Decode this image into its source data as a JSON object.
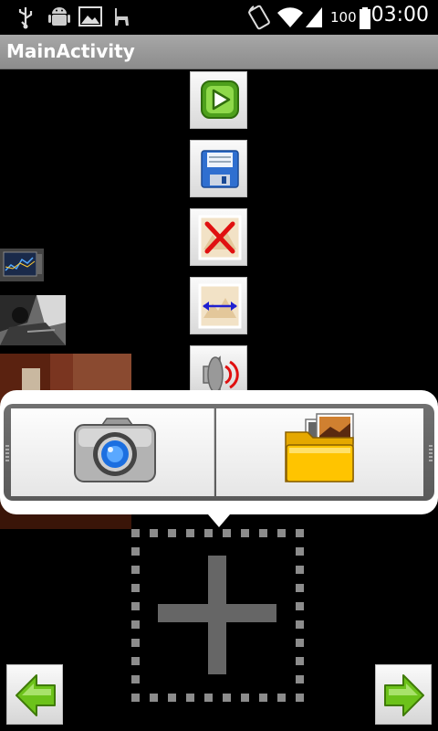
{
  "status_bar": {
    "battery_percent": "100",
    "time": "03:00",
    "notification_icons": [
      "usb-icon",
      "android-icon",
      "image-icon",
      "llama-icon"
    ],
    "system_icons": [
      "rotate-icon",
      "wifi-icon",
      "signal-icon",
      "battery-icon"
    ]
  },
  "title_bar": {
    "title": "MainActivity"
  },
  "toolbar": {
    "buttons": [
      "play-icon",
      "save-icon",
      "delete-icon",
      "resize-icon",
      "sound-icon"
    ]
  },
  "popup": {
    "options": [
      "camera-icon",
      "folder-images-icon"
    ]
  },
  "placeholder": {
    "icon": "add-plus-icon"
  },
  "navigation": {
    "prev_icon": "arrow-left-icon",
    "next_icon": "arrow-right-icon"
  },
  "colors": {
    "background": "#000000",
    "title_bar": "#999999",
    "nav_arrow": "#6cc21a",
    "popup_bg": "#ffffff"
  }
}
